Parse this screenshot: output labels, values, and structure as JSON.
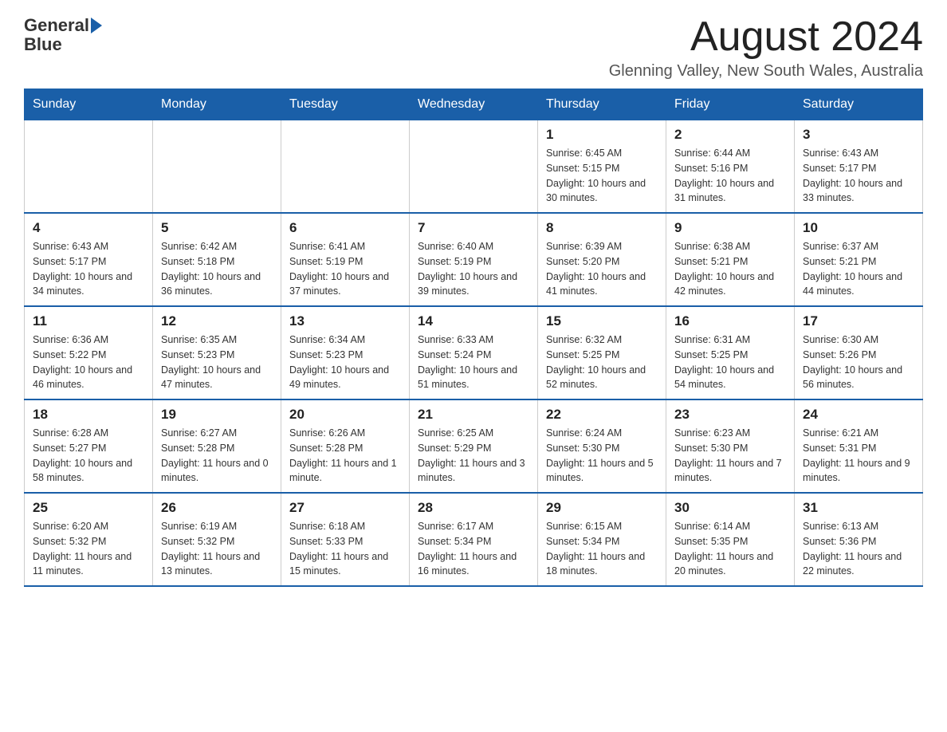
{
  "logo": {
    "text_general": "General",
    "text_blue": "Blue",
    "arrow": "▶"
  },
  "header": {
    "month_title": "August 2024",
    "location": "Glenning Valley, New South Wales, Australia"
  },
  "days_of_week": [
    "Sunday",
    "Monday",
    "Tuesday",
    "Wednesday",
    "Thursday",
    "Friday",
    "Saturday"
  ],
  "weeks": [
    [
      {
        "day": "",
        "info": ""
      },
      {
        "day": "",
        "info": ""
      },
      {
        "day": "",
        "info": ""
      },
      {
        "day": "",
        "info": ""
      },
      {
        "day": "1",
        "info": "Sunrise: 6:45 AM\nSunset: 5:15 PM\nDaylight: 10 hours and 30 minutes."
      },
      {
        "day": "2",
        "info": "Sunrise: 6:44 AM\nSunset: 5:16 PM\nDaylight: 10 hours and 31 minutes."
      },
      {
        "day": "3",
        "info": "Sunrise: 6:43 AM\nSunset: 5:17 PM\nDaylight: 10 hours and 33 minutes."
      }
    ],
    [
      {
        "day": "4",
        "info": "Sunrise: 6:43 AM\nSunset: 5:17 PM\nDaylight: 10 hours and 34 minutes."
      },
      {
        "day": "5",
        "info": "Sunrise: 6:42 AM\nSunset: 5:18 PM\nDaylight: 10 hours and 36 minutes."
      },
      {
        "day": "6",
        "info": "Sunrise: 6:41 AM\nSunset: 5:19 PM\nDaylight: 10 hours and 37 minutes."
      },
      {
        "day": "7",
        "info": "Sunrise: 6:40 AM\nSunset: 5:19 PM\nDaylight: 10 hours and 39 minutes."
      },
      {
        "day": "8",
        "info": "Sunrise: 6:39 AM\nSunset: 5:20 PM\nDaylight: 10 hours and 41 minutes."
      },
      {
        "day": "9",
        "info": "Sunrise: 6:38 AM\nSunset: 5:21 PM\nDaylight: 10 hours and 42 minutes."
      },
      {
        "day": "10",
        "info": "Sunrise: 6:37 AM\nSunset: 5:21 PM\nDaylight: 10 hours and 44 minutes."
      }
    ],
    [
      {
        "day": "11",
        "info": "Sunrise: 6:36 AM\nSunset: 5:22 PM\nDaylight: 10 hours and 46 minutes."
      },
      {
        "day": "12",
        "info": "Sunrise: 6:35 AM\nSunset: 5:23 PM\nDaylight: 10 hours and 47 minutes."
      },
      {
        "day": "13",
        "info": "Sunrise: 6:34 AM\nSunset: 5:23 PM\nDaylight: 10 hours and 49 minutes."
      },
      {
        "day": "14",
        "info": "Sunrise: 6:33 AM\nSunset: 5:24 PM\nDaylight: 10 hours and 51 minutes."
      },
      {
        "day": "15",
        "info": "Sunrise: 6:32 AM\nSunset: 5:25 PM\nDaylight: 10 hours and 52 minutes."
      },
      {
        "day": "16",
        "info": "Sunrise: 6:31 AM\nSunset: 5:25 PM\nDaylight: 10 hours and 54 minutes."
      },
      {
        "day": "17",
        "info": "Sunrise: 6:30 AM\nSunset: 5:26 PM\nDaylight: 10 hours and 56 minutes."
      }
    ],
    [
      {
        "day": "18",
        "info": "Sunrise: 6:28 AM\nSunset: 5:27 PM\nDaylight: 10 hours and 58 minutes."
      },
      {
        "day": "19",
        "info": "Sunrise: 6:27 AM\nSunset: 5:28 PM\nDaylight: 11 hours and 0 minutes."
      },
      {
        "day": "20",
        "info": "Sunrise: 6:26 AM\nSunset: 5:28 PM\nDaylight: 11 hours and 1 minute."
      },
      {
        "day": "21",
        "info": "Sunrise: 6:25 AM\nSunset: 5:29 PM\nDaylight: 11 hours and 3 minutes."
      },
      {
        "day": "22",
        "info": "Sunrise: 6:24 AM\nSunset: 5:30 PM\nDaylight: 11 hours and 5 minutes."
      },
      {
        "day": "23",
        "info": "Sunrise: 6:23 AM\nSunset: 5:30 PM\nDaylight: 11 hours and 7 minutes."
      },
      {
        "day": "24",
        "info": "Sunrise: 6:21 AM\nSunset: 5:31 PM\nDaylight: 11 hours and 9 minutes."
      }
    ],
    [
      {
        "day": "25",
        "info": "Sunrise: 6:20 AM\nSunset: 5:32 PM\nDaylight: 11 hours and 11 minutes."
      },
      {
        "day": "26",
        "info": "Sunrise: 6:19 AM\nSunset: 5:32 PM\nDaylight: 11 hours and 13 minutes."
      },
      {
        "day": "27",
        "info": "Sunrise: 6:18 AM\nSunset: 5:33 PM\nDaylight: 11 hours and 15 minutes."
      },
      {
        "day": "28",
        "info": "Sunrise: 6:17 AM\nSunset: 5:34 PM\nDaylight: 11 hours and 16 minutes."
      },
      {
        "day": "29",
        "info": "Sunrise: 6:15 AM\nSunset: 5:34 PM\nDaylight: 11 hours and 18 minutes."
      },
      {
        "day": "30",
        "info": "Sunrise: 6:14 AM\nSunset: 5:35 PM\nDaylight: 11 hours and 20 minutes."
      },
      {
        "day": "31",
        "info": "Sunrise: 6:13 AM\nSunset: 5:36 PM\nDaylight: 11 hours and 22 minutes."
      }
    ]
  ]
}
